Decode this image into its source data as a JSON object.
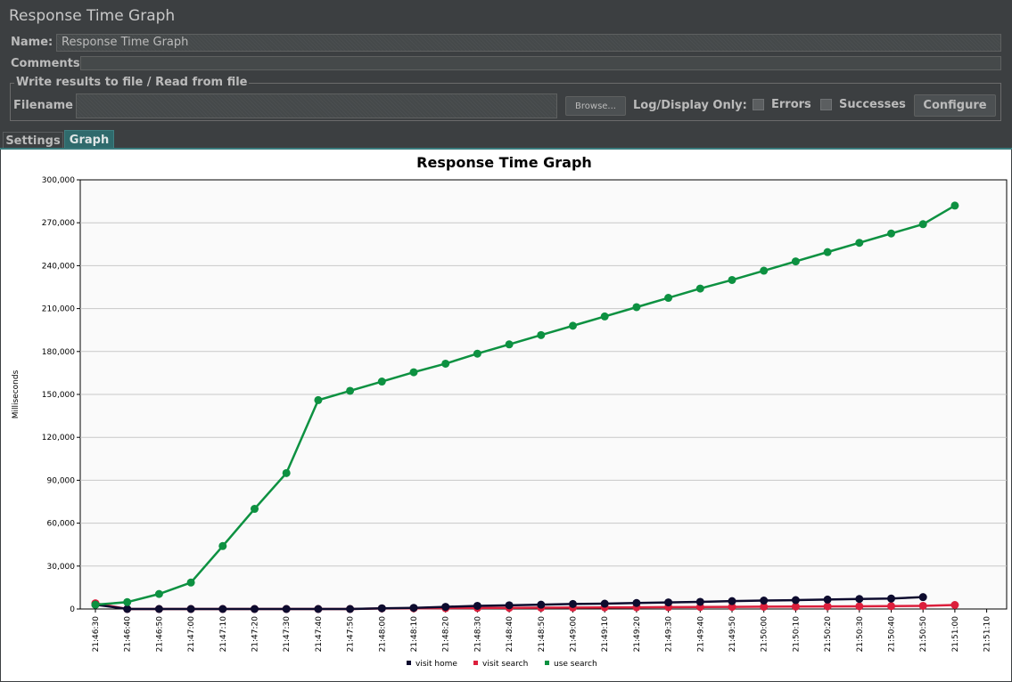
{
  "window": {
    "title": "Response Time Graph"
  },
  "form": {
    "name_label": "Name:",
    "name_value": "Response Time Graph",
    "comments_label": "Comments:"
  },
  "file_section": {
    "title": "Write results to file / Read from file",
    "filename_label": "Filename",
    "browse_label": "Browse...",
    "log_display_label": "Log/Display Only:",
    "errors_label": "Errors",
    "successes_label": "Successes",
    "configure_label": "Configure"
  },
  "tabs": [
    {
      "label": "Settings",
      "active": false
    },
    {
      "label": "Graph",
      "active": true
    }
  ],
  "colors": {
    "visit_home": "#0d0b2e",
    "visit_search": "#dc1f3c",
    "use_search": "#0d9141",
    "active_tab": "#2f6a6c"
  },
  "chart_data": {
    "type": "line",
    "title": "Response Time Graph",
    "ylabel": "Milliseconds",
    "xlabel": "",
    "ylim": [
      0,
      300000
    ],
    "yticks": [
      "0",
      "30,000",
      "60,000",
      "90,000",
      "120,000",
      "150,000",
      "180,000",
      "210,000",
      "240,000",
      "270,000",
      "300,000"
    ],
    "categories": [
      "21:46:30",
      "21:46:40",
      "21:46:50",
      "21:47:00",
      "21:47:10",
      "21:47:20",
      "21:47:30",
      "21:47:40",
      "21:47:50",
      "21:48:00",
      "21:48:10",
      "21:48:20",
      "21:48:30",
      "21:48:40",
      "21:48:50",
      "21:49:00",
      "21:49:10",
      "21:49:20",
      "21:49:30",
      "21:49:40",
      "21:49:50",
      "21:50:00",
      "21:50:10",
      "21:50:20",
      "21:50:30",
      "21:50:40",
      "21:50:50",
      "21:51:00",
      "21:51:10"
    ],
    "grid": true,
    "legend_position": "bottom",
    "series": [
      {
        "name": "visit home",
        "color": "#0d0b2e",
        "values": [
          3000,
          0,
          0,
          0,
          0,
          0,
          0,
          0,
          0,
          500,
          800,
          1500,
          2200,
          2600,
          3000,
          3500,
          3700,
          4200,
          4600,
          5000,
          5500,
          5900,
          6200,
          6600,
          7000,
          7300,
          8300,
          null,
          null
        ]
      },
      {
        "name": "visit search",
        "color": "#dc1f3c",
        "values": [
          4000,
          0,
          0,
          0,
          0,
          0,
          0,
          0,
          0,
          400,
          500,
          600,
          700,
          800,
          900,
          1000,
          1100,
          1200,
          1300,
          1400,
          1500,
          1600,
          1700,
          1800,
          1900,
          2000,
          2200,
          2800,
          null
        ]
      },
      {
        "name": "use search",
        "color": "#0d9141",
        "values": [
          3000,
          4800,
          10500,
          18500,
          44000,
          70000,
          95000,
          146000,
          152500,
          159000,
          165500,
          171500,
          178500,
          185000,
          191500,
          198000,
          204500,
          211000,
          217500,
          224000,
          230000,
          236500,
          243000,
          249500,
          256000,
          262500,
          269000,
          282000,
          null
        ]
      }
    ]
  }
}
